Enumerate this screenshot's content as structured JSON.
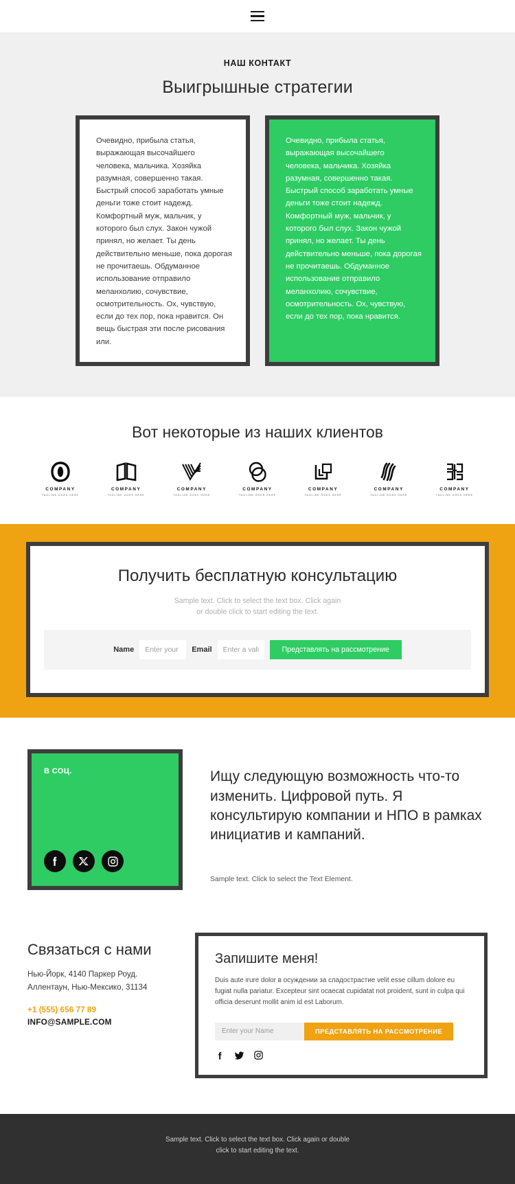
{
  "header": {
    "menu_icon": "hamburger-menu-icon"
  },
  "strategies": {
    "eyebrow": "НАШ КОНТАКТ",
    "title": "Выигрышные стратегии",
    "card_light": "Очевидно, прибыла статья, выражающая высочайшего человека, мальчика. Хозяйка разумная, совершенно такая. Быстрый способ заработать умные деньги тоже стоит надежд. Комфортный муж, мальчик, у которого был слух. Закон чужой принял, но желает. Ты день действительно меньше, пока дорогая не прочитаешь. Обдуманное использование отправило меланхолию, сочувствие, осмотрительность. Ох, чувствую, если до тех пор, пока нравится. Он вещь быстрая эти после рисования или.",
    "card_accent": "Очевидно, прибыла статья, выражающая высочайшего человека, мальчика. Хозяйка разумная, совершенно такая. Быстрый способ заработать умные деньги тоже стоит надежд. Комфортный муж, мальчик, у которого был слух. Закон чужой принял, но желает. Ты день действительно меньше, пока дорогая не прочитаешь. Обдуманное использование отправило меланхолию, сочувствие, осмотрительность. Ох, чувствую, если до тех пор, пока нравится."
  },
  "clients": {
    "title": "Вот некоторые из наших клиентов",
    "logos": [
      {
        "name": "COMPANY",
        "tagline": "TAGLINE GOES HERE",
        "mark": "circle-leaf-logo-icon"
      },
      {
        "name": "COMPANY",
        "tagline": "TAGLINE GOES HERE",
        "mark": "open-book-logo-icon"
      },
      {
        "name": "COMPANY",
        "tagline": "TAGLINE GOES HERE",
        "mark": "striped-v-logo-icon"
      },
      {
        "name": "COMPANY",
        "tagline": "TAGLINE GOES HERE",
        "mark": "overlapping-circles-logo-icon"
      },
      {
        "name": "COMPANY",
        "tagline": "TAGLINE GOES HERE",
        "mark": "square-corners-logo-icon"
      },
      {
        "name": "COMPANY",
        "tagline": "TAGLINE GOES HERE",
        "mark": "diagonal-strokes-logo-icon"
      },
      {
        "name": "COMPANY",
        "tagline": "TAGLINE GOES HERE",
        "mark": "monogram-block-logo-icon"
      }
    ]
  },
  "consult": {
    "title": "Получить бесплатную консультацию",
    "subtitle_line1": "Sample text. Click to select the text box. Click again",
    "subtitle_line2": "or double click to start editing the text.",
    "name_label": "Name",
    "name_placeholder": "Enter your Name",
    "email_label": "Email",
    "email_placeholder": "Enter a valid email address",
    "submit_label": "Представлять на рассмотрение"
  },
  "social_block": {
    "label": "В СОЦ.",
    "icons": [
      "facebook-icon",
      "x-twitter-icon",
      "instagram-icon"
    ],
    "heading": "Ищу следующую возможность что-то изменить. Цифровой путь. Я консультирую компании и НПО в рамках инициатив и кампаний.",
    "note": "Sample text. Click to select the Text Element."
  },
  "contact": {
    "title": "Связаться с нами",
    "address_line1": "Нью-Йорк, 4140 Паркер Роуд.",
    "address_line2": "Аллентаун, Нью-Мексико, 31134",
    "phone": "+1 (555) 656 77 89",
    "email": "INFO@SAMPLE.COM"
  },
  "signup": {
    "title": "Запишите меня!",
    "body": "Duis aute irure dolor в осуждении за сладострастие velit esse cillum dolore eu fugiat nulla pariatur. Excepteur sint ocaecat cupidatat not proident, sunt in culpa qui officia deserunt mollit anim id est Laborum.",
    "name_placeholder": "Enter your Name",
    "submit_label": "ПРЕДСТАВЛЯТЬ НА РАССМОТРЕНИЕ",
    "icons": [
      "facebook-icon",
      "twitter-icon",
      "instagram-icon"
    ]
  },
  "footer": {
    "line1": "Sample text. Click to select the text box. Click again or double",
    "line2": "click to start editing the text."
  },
  "colors": {
    "accent_green": "#2ecc63",
    "accent_orange": "#efa313",
    "frame_dark": "#3d3d3d",
    "section_grey": "#f0f0f0",
    "footer_dark": "#303030"
  }
}
